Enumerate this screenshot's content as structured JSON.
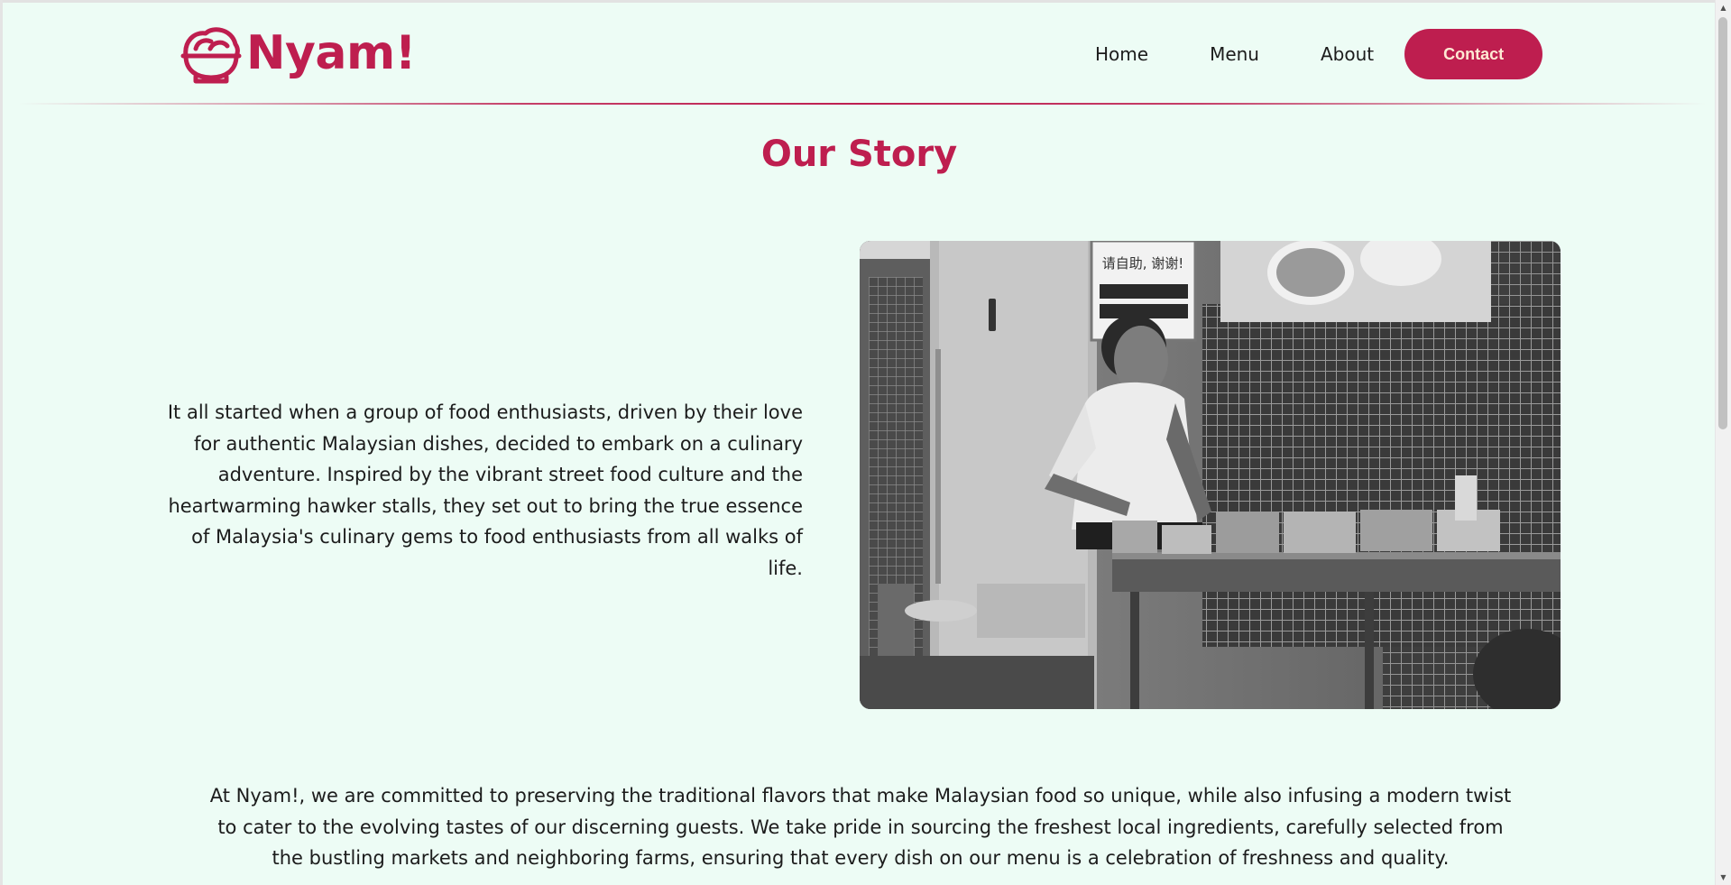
{
  "brand": {
    "name": "Nyam!",
    "color": "#be1e4f",
    "icon": "noodle-bowl-icon"
  },
  "nav": {
    "items": [
      "Home",
      "Menu",
      "About"
    ],
    "contact_label": "Contact"
  },
  "main": {
    "title": "Our Story",
    "story": "It all started when a group of food enthusiasts, driven by their love for authentic Malaysian dishes, decided to embark on a culinary adventure. Inspired by the vibrant street food culture and the heartwarming hawker stalls, they set out to bring the true essence of Malaysia's culinary gems to food enthusiasts from all walks of life.",
    "photo_description": "Black and white photo of a hawker cooking at a street food stall",
    "photo_sign_text": "请自助, 谢谢!",
    "mission": "At Nyam!, we are committed to preserving the traditional flavors that make Malaysian food so unique, while also infusing a modern twist to cater to the evolving tastes of our discerning guests. We take pride in sourcing the freshest local ingredients, carefully selected from the bustling markets and neighboring farms, ensuring that every dish on our menu is a celebration of freshness and quality."
  },
  "colors": {
    "background": "#edfcf5",
    "accent": "#be1e4f",
    "button_text": "#ffe9d4"
  }
}
